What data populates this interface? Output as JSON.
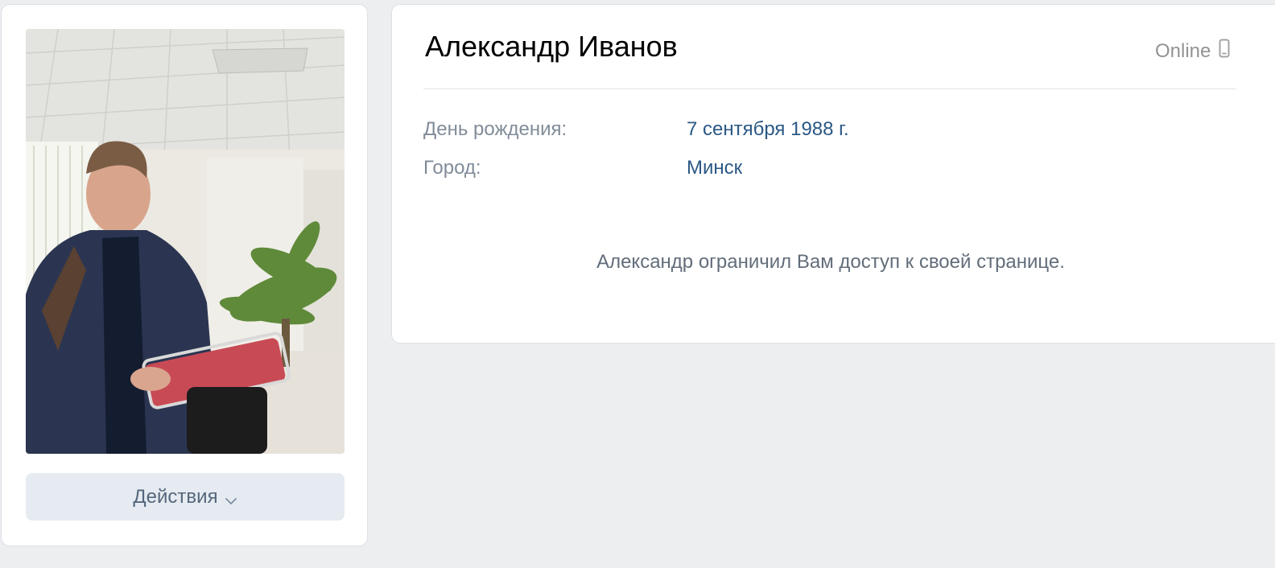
{
  "profile": {
    "name": "Александр Иванов",
    "status": "Online",
    "status_icon": "mobile-phone-icon",
    "actions_label": "Действия",
    "info": [
      {
        "label": "День рождения:",
        "value": "7 сентября 1988 г."
      },
      {
        "label": "Город:",
        "value": "Минск"
      }
    ],
    "restricted_message": "Александр ограничил Вам доступ к своей странице."
  },
  "colors": {
    "background": "#edeef0",
    "card": "#ffffff",
    "link": "#2a5885",
    "label": "#818c99",
    "button_bg": "#e5ebf1",
    "button_text": "#55677d"
  }
}
